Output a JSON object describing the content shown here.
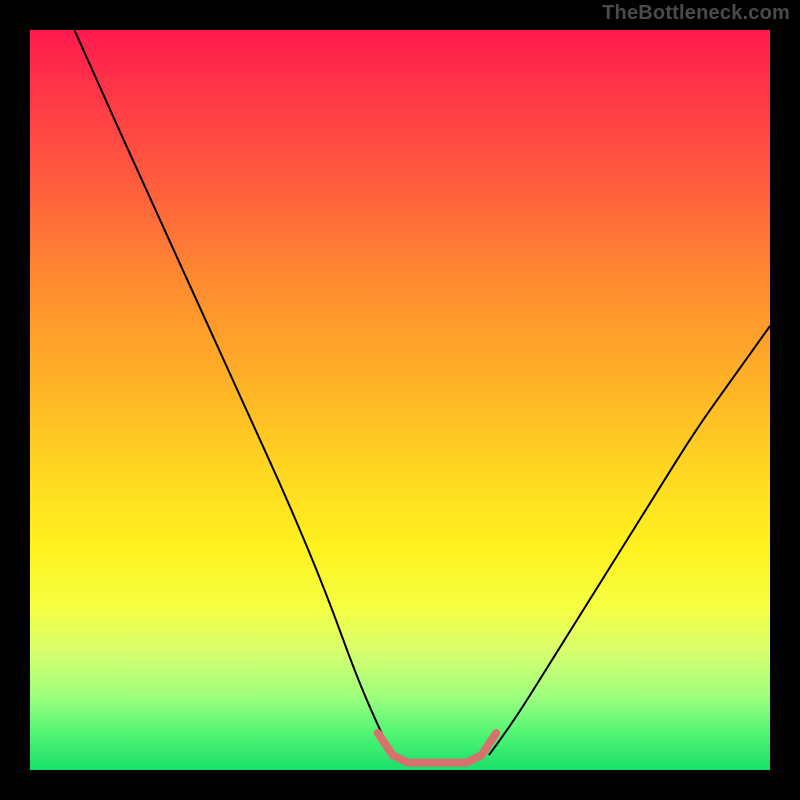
{
  "watermark": "TheBottleneck.com",
  "chart_data": {
    "type": "line",
    "title": "",
    "xlabel": "",
    "ylabel": "",
    "xlim": [
      0,
      100
    ],
    "ylim": [
      0,
      100
    ],
    "grid": false,
    "legend": false,
    "series": [
      {
        "name": "curve-left",
        "color": "#000000",
        "x": [
          6,
          10,
          15,
          20,
          25,
          30,
          35,
          40,
          44,
          47,
          49
        ],
        "y": [
          100,
          91,
          80,
          69,
          58,
          47,
          36,
          24,
          13,
          6,
          2
        ]
      },
      {
        "name": "curve-right",
        "color": "#000000",
        "x": [
          62,
          65,
          70,
          75,
          80,
          85,
          90,
          95,
          100
        ],
        "y": [
          2,
          6,
          14,
          22,
          30,
          38,
          46,
          53,
          60
        ]
      },
      {
        "name": "valley-highlight",
        "color": "#d9706d",
        "x": [
          47,
          49,
          51,
          53,
          55,
          57,
          59,
          61,
          63
        ],
        "y": [
          5,
          2,
          1,
          1,
          1,
          1,
          1,
          2,
          5
        ]
      }
    ],
    "annotations": []
  }
}
